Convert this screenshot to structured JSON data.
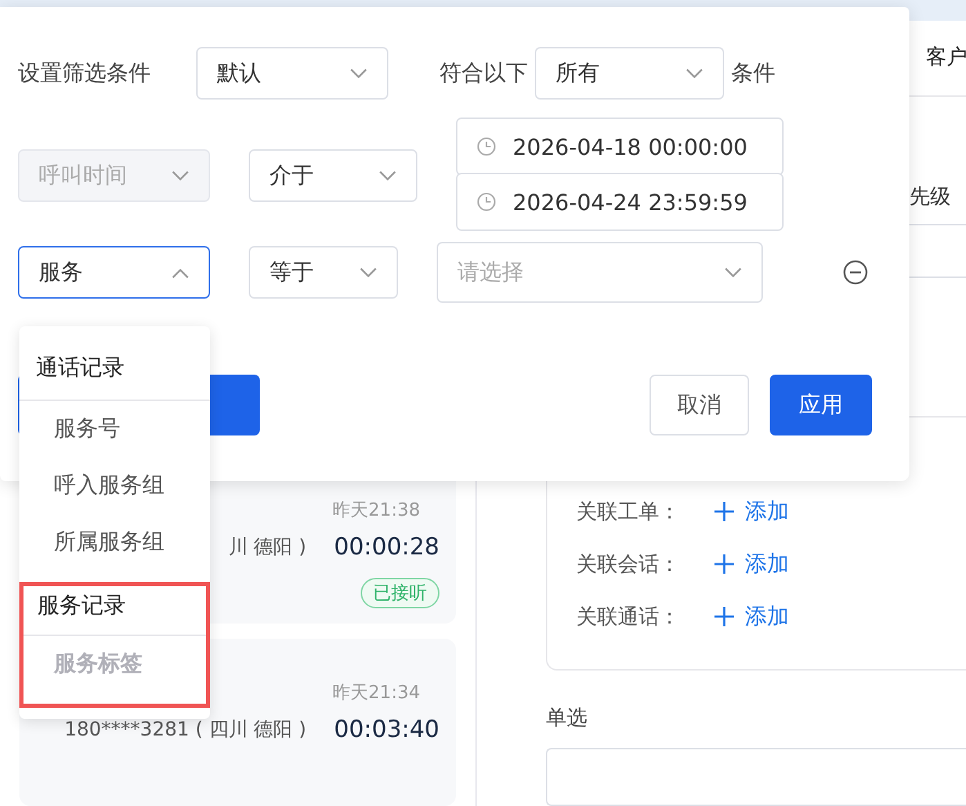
{
  "background": {
    "tab": {
      "label": "客户"
    },
    "field_label": "先级",
    "call_cards": [
      {
        "time": "昨天21:38",
        "phone": "川 德阳 )",
        "duration": "00:00:28",
        "status": "已接听"
      },
      {
        "time": "昨天21:34",
        "phone": "180****3281 ( 四川 德阳 )",
        "duration": "00:03:40"
      }
    ],
    "relations": [
      {
        "label": "关联工单：",
        "action": "添加"
      },
      {
        "label": "关联会话：",
        "action": "添加"
      },
      {
        "label": "关联通话：",
        "action": "添加"
      }
    ],
    "single_choice": {
      "label": "单选"
    }
  },
  "filter_panel": {
    "label": "设置筛选条件",
    "preset": {
      "value": "默认"
    },
    "match_prefix": "符合以下",
    "match": {
      "value": "所有"
    },
    "match_suffix": "条件",
    "conditions": [
      {
        "field": {
          "value": "呼叫时间",
          "disabled": true,
          "open": false
        },
        "operator": {
          "value": "介于"
        },
        "value": {
          "kind": "date-range",
          "start": "2026-04-18 00:00:00",
          "end": "2026-04-24 23:59:59"
        },
        "removable": false
      },
      {
        "field": {
          "value": "服务",
          "disabled": false,
          "open": true
        },
        "operator": {
          "value": "等于"
        },
        "value": {
          "kind": "select",
          "placeholder": "请选择"
        },
        "removable": true
      }
    ],
    "buttons": [
      {
        "label": "取消",
        "primary": false
      },
      {
        "label": "应用",
        "primary": true
      }
    ]
  },
  "dropdown": {
    "groups": [
      {
        "label": "通话记录",
        "highlighted": false,
        "items": [
          {
            "label": "服务号",
            "disabled": false
          },
          {
            "label": "呼入服务组",
            "disabled": false
          },
          {
            "label": "所属服务组",
            "disabled": false
          }
        ]
      },
      {
        "label": "服务记录",
        "highlighted": true,
        "items": [
          {
            "label": "服务标签",
            "disabled": true
          }
        ]
      }
    ]
  }
}
